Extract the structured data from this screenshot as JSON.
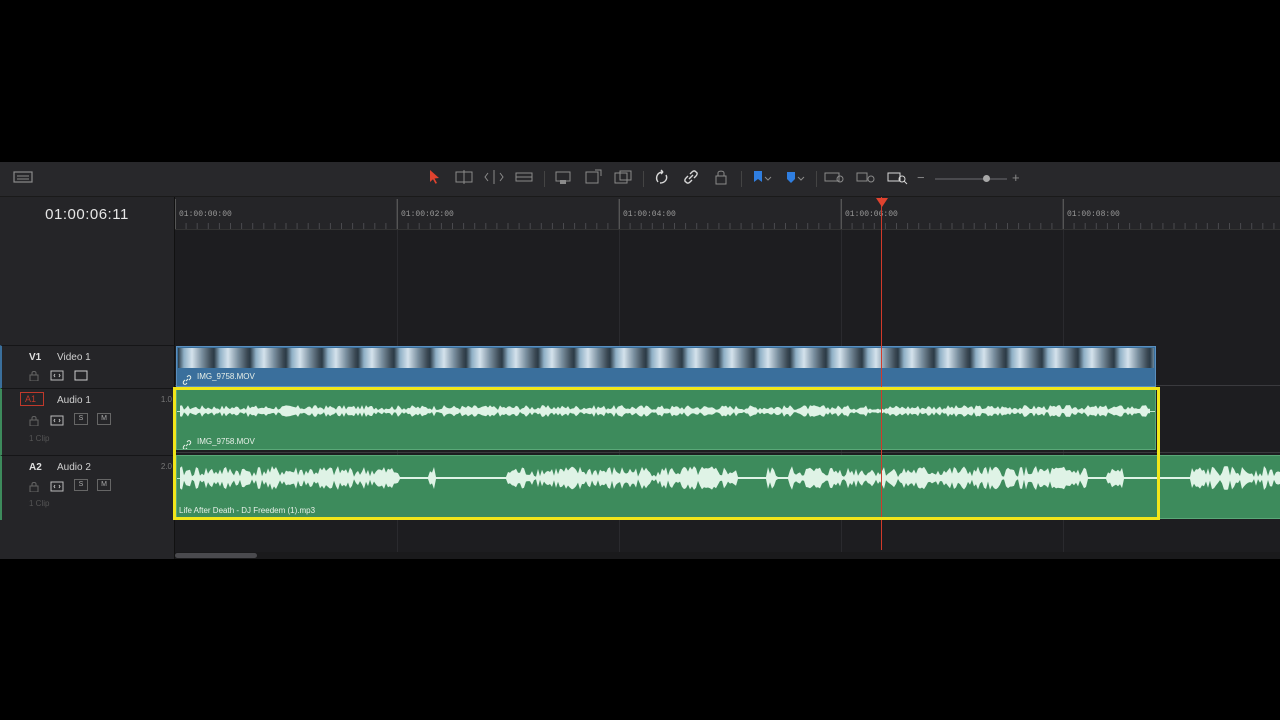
{
  "timecode": "01:00:06:11",
  "ruler": {
    "labels": [
      "01:00:00:00",
      "01:00:02:00",
      "01:00:04:00",
      "01:00:06:00",
      "01:00:08:00"
    ]
  },
  "toolbar": {
    "icons": [
      "selection-tool-icon",
      "trim-edit-icon",
      "dynamic-trim-icon",
      "blade-tool-icon",
      "insert-clip-icon",
      "overwrite-clip-icon",
      "replace-clip-icon",
      "snapping-icon",
      "linked-selection-icon",
      "position-lock-icon",
      "flag-icon",
      "marker-icon",
      "zoom-full-icon",
      "zoom-detail-icon",
      "zoom-custom-icon"
    ],
    "zoom_minus": "−",
    "zoom_plus": "+",
    "zoom_level": 0.5
  },
  "tracks": [
    {
      "id": "V1",
      "name": "Video 1",
      "number": "",
      "sub": ""
    },
    {
      "id": "A1",
      "name": "Audio 1",
      "number": "1.0",
      "sub": "1 Clip",
      "solo": "S",
      "mute": "M"
    },
    {
      "id": "A2",
      "name": "Audio 2",
      "number": "2.0",
      "sub": "1 Clip",
      "solo": "S",
      "mute": "M"
    }
  ],
  "clips": {
    "video": "IMG_9758.MOV",
    "audio1": "IMG_9758.MOV",
    "audio2": "Life After Death - DJ Freedem (1).mp3"
  },
  "colors": {
    "playhead": "#d13a2a",
    "highlight": "#f1e61a",
    "audio_clip": "#3d8b5c",
    "video_clip": "#3a6f9c"
  }
}
